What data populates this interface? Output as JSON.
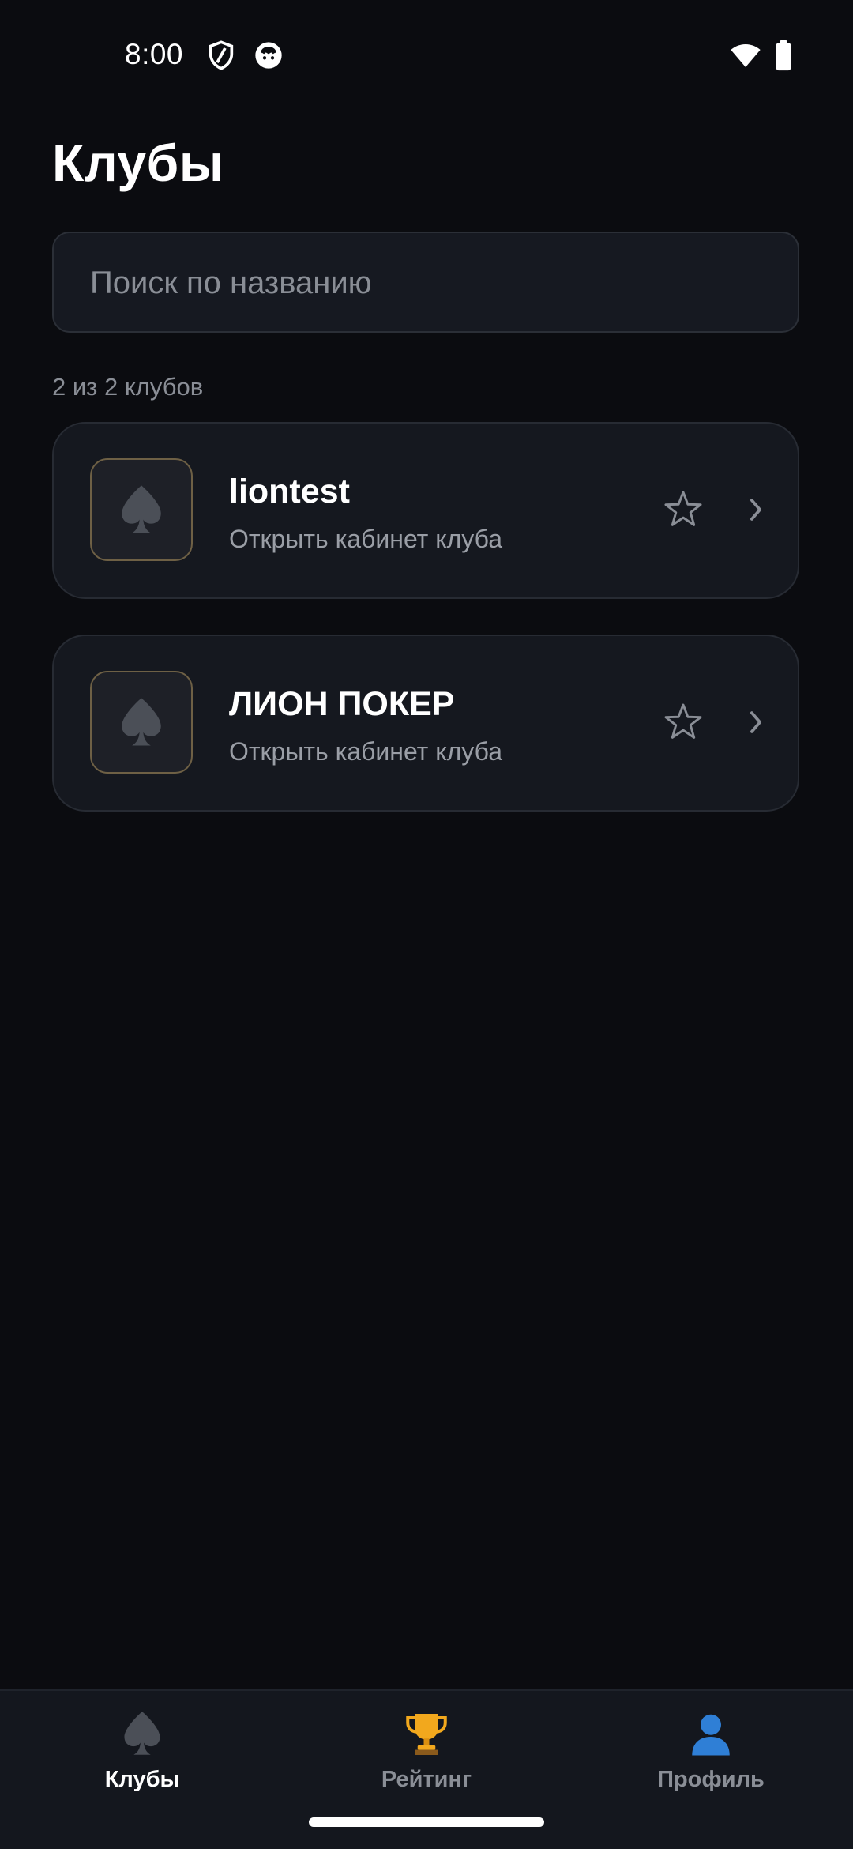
{
  "status_bar": {
    "time": "8:00",
    "icons": [
      "shield-icon",
      "face-icon",
      "wifi-icon",
      "battery-icon"
    ]
  },
  "header": {
    "title": "Клубы"
  },
  "search": {
    "placeholder": "Поиск по названию",
    "value": ""
  },
  "clubs": {
    "count_text": "2 из 2 клубов",
    "items": [
      {
        "name": "liontest",
        "subtitle": "Открыть кабинет клуба",
        "logo_icon": "spade-icon",
        "favorite": false
      },
      {
        "name": "ЛИОН ПОКЕР",
        "subtitle": "Открыть кабинет клуба",
        "logo_icon": "spade-icon",
        "favorite": false
      }
    ]
  },
  "bottom_nav": {
    "items": [
      {
        "label": "Клубы",
        "icon": "spade-icon",
        "active": true
      },
      {
        "label": "Рейтинг",
        "icon": "trophy-icon",
        "active": false
      },
      {
        "label": "Профиль",
        "icon": "user-icon",
        "active": false
      }
    ]
  },
  "colors": {
    "background": "#0b0c10",
    "card": "#15181f",
    "logo_border": "#6e6045",
    "muted_text": "#8a8e96",
    "trophy": "#f2a81d",
    "profile": "#2f7fd6"
  }
}
